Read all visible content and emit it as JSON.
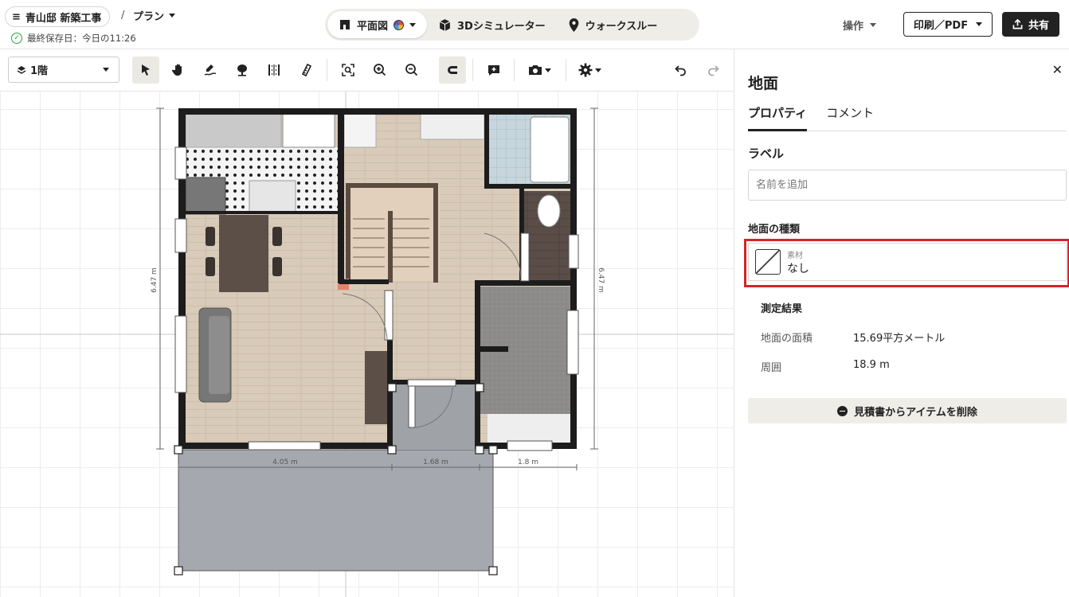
{
  "header": {
    "project_name": "青山邸 新築工事",
    "breadcrumb_sep": "/",
    "plan_label": "プラン",
    "saved_text": "最終保存日：今日の11:26",
    "views": [
      {
        "label": "平面図",
        "icon": "floorplan-icon",
        "active": true
      },
      {
        "label": "3Dシミュレーター",
        "icon": "cube-icon",
        "active": false
      },
      {
        "label": "ウォークスルー",
        "icon": "location-pin-icon",
        "active": false
      }
    ],
    "ops_label": "操作",
    "print_label": "印刷／PDF",
    "share_label": "共有"
  },
  "toolbar": {
    "floor_label": "1階",
    "tools": [
      "select-arrow-icon",
      "hand-pan-icon",
      "draw-pen-icon",
      "tree-icon",
      "dimension-icon",
      "measure-ruler-icon",
      "zoom-fit-icon",
      "zoom-in-icon",
      "zoom-out-icon",
      "magnet-snap-icon",
      "add-comment-icon",
      "camera-icon",
      "settings-gear-icon",
      "undo-icon",
      "redo-icon"
    ]
  },
  "plan": {
    "dims": {
      "height_left": "6.47 m",
      "height_right": "6.47 m",
      "seg1": "4.05 m",
      "seg2": "1.68 m",
      "seg3": "1.8 m"
    }
  },
  "panel": {
    "title": "地面",
    "tabs": [
      "プロパティ",
      "コメント"
    ],
    "label_heading": "ラベル",
    "name_placeholder": "名前を追加",
    "ground_type_heading": "地面の種類",
    "material_caption": "素材",
    "material_value": "なし",
    "measure_heading": "測定結果",
    "area_label": "地面の面積",
    "area_value": "15.69平方メートル",
    "perimeter_label": "周囲",
    "perimeter_value": "18.9 m",
    "remove_label": "見積書からアイテムを削除"
  },
  "colors": {
    "highlight": "#d8232a",
    "wall": "#1c1c1c",
    "ground": "#a5a8ae",
    "wood_floor": "#d9cbb9"
  }
}
